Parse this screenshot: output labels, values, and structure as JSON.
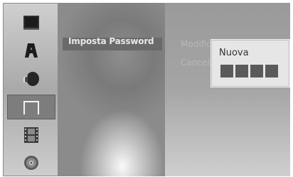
{
  "sidebar": {
    "items": [
      {
        "icon": "screen-icon",
        "active": false
      },
      {
        "icon": "language-icon",
        "active": false
      },
      {
        "icon": "audio-icon",
        "active": false
      },
      {
        "icon": "lock-icon",
        "active": true
      },
      {
        "icon": "film-icon",
        "active": false
      },
      {
        "icon": "disc-icon",
        "active": false
      }
    ]
  },
  "menu": {
    "selected_label": "Imposta Password"
  },
  "submenu": {
    "items": [
      {
        "label": "Modifica"
      },
      {
        "label": "Cancella"
      }
    ]
  },
  "popup": {
    "title": "Nuova",
    "pin_length": 4
  }
}
